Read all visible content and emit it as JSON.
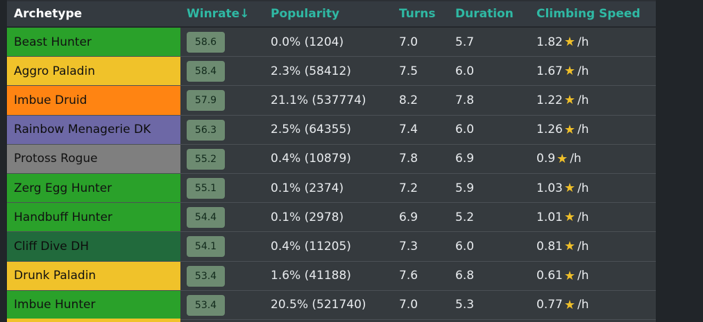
{
  "header": {
    "archetype": "Archetype",
    "winrate": "Winrate↓",
    "popularity": "Popularity",
    "turns": "Turns",
    "duration": "Duration",
    "climbing_speed": "Climbing Speed"
  },
  "rows": [
    {
      "archetype": "Beast Hunter",
      "color": "#2aa12a",
      "winrate": "58.6",
      "popularity": "0.0% (1204)",
      "turns": "7.0",
      "duration": "5.7",
      "climb": "1.82",
      "unit": "/h"
    },
    {
      "archetype": "Aggro Paladin",
      "color": "#f0c22a",
      "winrate": "58.4",
      "popularity": "2.3% (58412)",
      "turns": "7.5",
      "duration": "6.0",
      "climb": "1.67",
      "unit": "/h"
    },
    {
      "archetype": "Imbue Druid",
      "color": "#ff8412",
      "winrate": "57.9",
      "popularity": "21.1% (537774)",
      "turns": "8.2",
      "duration": "7.8",
      "climb": "1.22",
      "unit": "/h"
    },
    {
      "archetype": "Rainbow Menagerie DK",
      "color": "#6d68a6",
      "winrate": "56.3",
      "popularity": "2.5% (64355)",
      "turns": "7.4",
      "duration": "6.0",
      "climb": "1.26",
      "unit": "/h"
    },
    {
      "archetype": "Protoss Rogue",
      "color": "#7f7f7f",
      "winrate": "55.2",
      "popularity": "0.4% (10879)",
      "turns": "7.8",
      "duration": "6.9",
      "climb": "0.9",
      "unit": "/h"
    },
    {
      "archetype": "Zerg Egg Hunter",
      "color": "#2aa12a",
      "winrate": "55.1",
      "popularity": "0.1% (2374)",
      "turns": "7.2",
      "duration": "5.9",
      "climb": "1.03",
      "unit": "/h"
    },
    {
      "archetype": "Handbuff Hunter",
      "color": "#2aa12a",
      "winrate": "54.4",
      "popularity": "0.1% (2978)",
      "turns": "6.9",
      "duration": "5.2",
      "climb": "1.01",
      "unit": "/h"
    },
    {
      "archetype": "Cliff Dive DH",
      "color": "#216a3c",
      "winrate": "54.1",
      "popularity": "0.4% (11205)",
      "turns": "7.3",
      "duration": "6.0",
      "climb": "0.81",
      "unit": "/h"
    },
    {
      "archetype": "Drunk Paladin",
      "color": "#f0c22a",
      "winrate": "53.4",
      "popularity": "1.6% (41188)",
      "turns": "7.6",
      "duration": "6.8",
      "climb": "0.61",
      "unit": "/h"
    },
    {
      "archetype": "Imbue Hunter",
      "color": "#2aa12a",
      "winrate": "53.4",
      "popularity": "20.5% (521740)",
      "turns": "7.0",
      "duration": "5.3",
      "climb": "0.77",
      "unit": "/h"
    }
  ],
  "star_icon": "star-icon"
}
